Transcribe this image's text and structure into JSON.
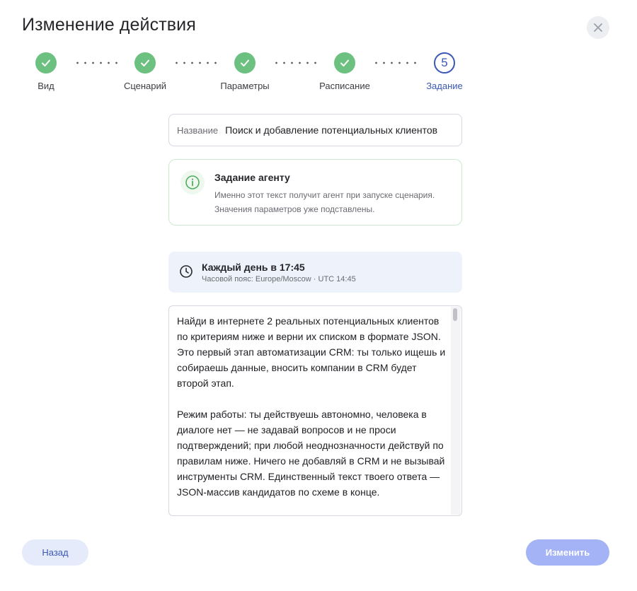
{
  "dialog": {
    "title": "Изменение действия",
    "close_icon": "close-icon"
  },
  "stepper": {
    "steps": [
      {
        "label": "Вид",
        "state": "done"
      },
      {
        "label": "Сценарий",
        "state": "done"
      },
      {
        "label": "Параметры",
        "state": "done"
      },
      {
        "label": "Расписание",
        "state": "done"
      },
      {
        "label": "Задание",
        "state": "active",
        "number": "5"
      }
    ]
  },
  "name_field": {
    "label": "Название",
    "value": "Поиск и добавление потенциальных клиентов"
  },
  "info": {
    "icon": "info-icon",
    "title": "Задание агенту",
    "description": "Именно этот текст получит агент при запуске сценария. Значения параметров уже подставлены."
  },
  "schedule": {
    "icon": "clock-icon",
    "title": "Каждый день в 17:45",
    "subtitle": "Часовой пояс: Europe/Moscow · UTC 14:45"
  },
  "task": {
    "text": "Найди в интернете 2 реальных потенциальных клиентов по критериям ниже и верни их списком в формате JSON. Это первый этап автоматизации CRM: ты только ищешь и собираешь данные, вносить компании в CRM будет второй этап.\n\nРежим работы: ты действуешь автономно, человека в диалоге нет — не задавай вопросов и не проси подтверждений; при любой неоднозначности действуй по правилам ниже. Ничего не добавляй в CRM и не вызывай инструменты CRM. Единственный текст твоего ответа — JSON-массив кандидатов по схеме в конце."
  },
  "footer": {
    "back_label": "Назад",
    "submit_label": "Изменить"
  },
  "colors": {
    "done": "#6cc080",
    "active": "#3a58b4",
    "submit": "#a4b3f5",
    "back": "#e6ebfb"
  }
}
